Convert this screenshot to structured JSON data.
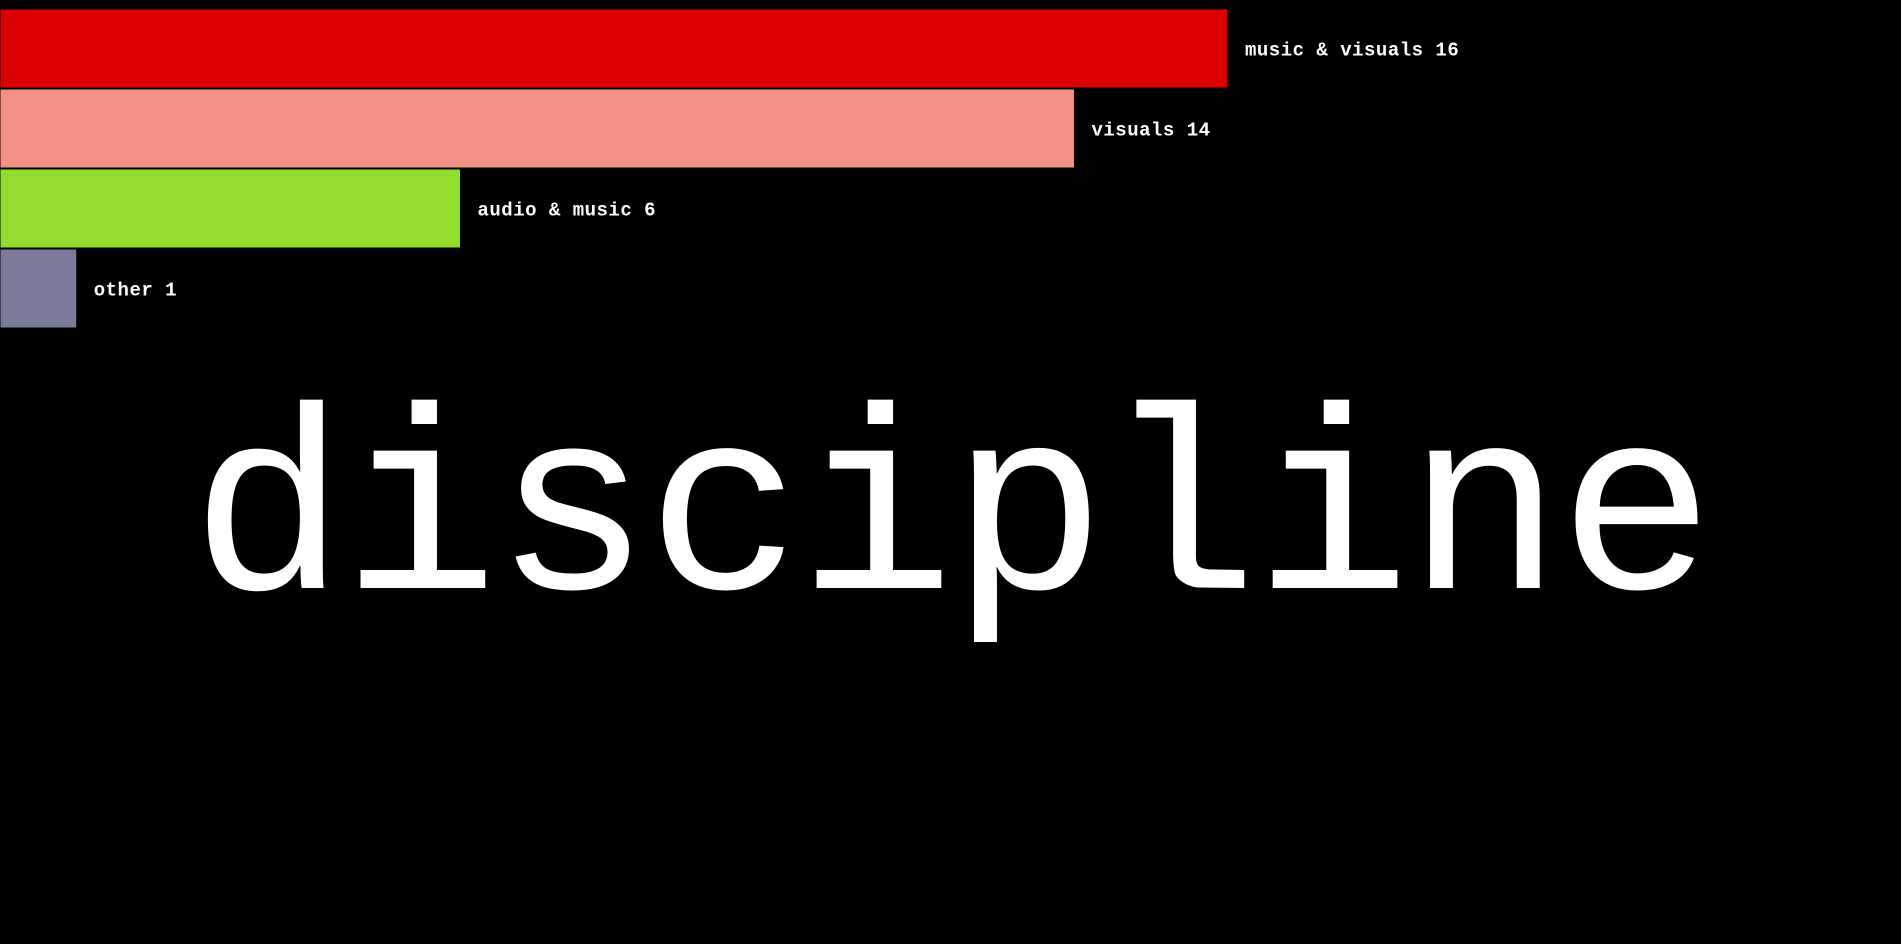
{
  "chart_data": {
    "type": "bar",
    "orientation": "horizontal",
    "categories": [
      "music & visuals",
      "visuals",
      "audio & music",
      "other"
    ],
    "values": [
      16,
      14,
      6,
      1
    ],
    "labels": [
      "music & visuals 16",
      "visuals 14",
      "audio & music 6",
      "other 1"
    ],
    "colors": [
      "#dd0000",
      "#f19083",
      "#91dc2c",
      "#7a7b98"
    ],
    "xlim": [
      0,
      16
    ],
    "grid": false,
    "legend": "none"
  },
  "title": {
    "text": "discipline",
    "color": "#ffffff"
  },
  "colors": {
    "background": "#000000",
    "label": "#ffffff"
  }
}
